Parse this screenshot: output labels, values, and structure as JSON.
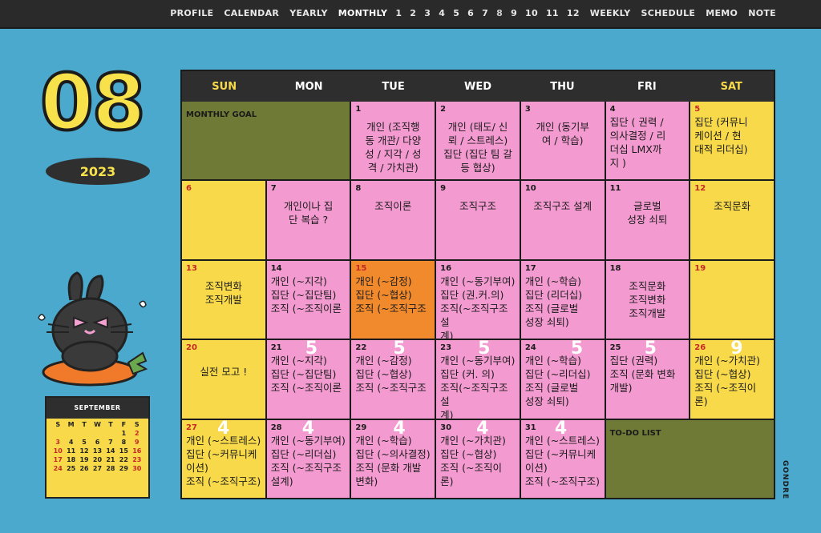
{
  "nav": {
    "items": [
      "PROFILE",
      "CALENDAR",
      "YEARLY",
      "MONTHLY"
    ],
    "months": [
      "1",
      "2",
      "3",
      "4",
      "5",
      "6",
      "7",
      "8",
      "9",
      "10",
      "11",
      "12"
    ],
    "items2": [
      "WEEKLY",
      "SCHEDULE",
      "MEMO",
      "NOTE"
    ]
  },
  "month": "08",
  "year": "2023",
  "mini": {
    "title": "SEPTEMBER",
    "dow": [
      "S",
      "M",
      "T",
      "W",
      "T",
      "F",
      "S"
    ],
    "days": [
      "",
      "",
      "",
      "",
      "",
      "1",
      "2",
      "3",
      "4",
      "5",
      "6",
      "7",
      "8",
      "9",
      "10",
      "11",
      "12",
      "13",
      "14",
      "15",
      "16",
      "17",
      "18",
      "19",
      "20",
      "21",
      "22",
      "23",
      "24",
      "25",
      "26",
      "27",
      "28",
      "29",
      "30"
    ]
  },
  "weekdays": [
    "SUN",
    "MON",
    "TUE",
    "WED",
    "THU",
    "FRI",
    "SAT"
  ],
  "goal_label": "MONTHLY GOAL",
  "todo_label": "TO-DO LIST",
  "cells": {
    "d1": {
      "n": "1",
      "t": "개인 (조직행\n동 개관/ 다양\n성 / 지각 / 성\n격 / 가치관)"
    },
    "d2": {
      "n": "2",
      "t": "개인 (태도/ 신\n뢰 / 스트레스)\n집단 (집단 팀 갈\n등 협상)"
    },
    "d3": {
      "n": "3",
      "t": "개인 (동기부\n여 / 학습)"
    },
    "d4": {
      "n": "4",
      "t": "집단 ( 권력 /\n의사결정 / 리\n더십 LMX까\n지 )"
    },
    "d5": {
      "n": "5",
      "t": "집단 (커뮤니\n케이션 / 현\n대적 리더십)"
    },
    "d6": {
      "n": "6",
      "t": ""
    },
    "d7": {
      "n": "7",
      "t": "개인이나 집\n단 복습 ?"
    },
    "d8": {
      "n": "8",
      "t": "조직이론"
    },
    "d9": {
      "n": "9",
      "t": "조직구조"
    },
    "d10": {
      "n": "10",
      "t": "조직구조 설계"
    },
    "d11": {
      "n": "11",
      "t": "글로벌\n성장 쇠퇴"
    },
    "d12": {
      "n": "12",
      "t": "조직문화"
    },
    "d13": {
      "n": "13",
      "t": "조직변화\n조직개발"
    },
    "d14": {
      "n": "14",
      "t": "개인 (~지각)\n집단 (~집단팀)\n조직 (~조직이론"
    },
    "d15": {
      "n": "15",
      "t": "개인 (~감정)\n집단 (~협상)\n조직 (~조직구조"
    },
    "d16": {
      "n": "16",
      "t": "개인 (~동기부여)\n집단 (권.커.의)\n조직(~조직구조설\n계)"
    },
    "d17": {
      "n": "17",
      "t": "개인 (~학습)\n집단 (리더십)\n조직 (글로벌\n성장 쇠퇴)"
    },
    "d18": {
      "n": "18",
      "t": "조직문화\n조직변화\n조직개발"
    },
    "d19": {
      "n": "19",
      "t": ""
    },
    "d20": {
      "n": "20",
      "t": "실전 모고 !"
    },
    "d21": {
      "n": "21",
      "t": "개인 (~지각)\n집단 (~집단팀)\n조직 (~조직이론",
      "h": "5"
    },
    "d22": {
      "n": "22",
      "t": "개인 (~감정)\n집단 (~협상)\n조직 (~조직구조",
      "h": "5"
    },
    "d23": {
      "n": "23",
      "t": "개인 (~동기부여)\n집단 (커. 의)\n조직(~조직구조설\n계)",
      "h": "5"
    },
    "d24": {
      "n": "24",
      "t": "개인 (~학습)\n집단 (~리더십)\n조직 (글로벌\n성장 쇠퇴)",
      "h": "5"
    },
    "d25": {
      "n": "25",
      "t": "집단 (권력)\n조직 (문화 변화\n개발)",
      "h": "5"
    },
    "d26": {
      "n": "26",
      "t": "개인 (~가치관)\n집단 (~협상)\n조직 (~조직이\n론)",
      "h": "9"
    },
    "d27": {
      "n": "27",
      "t": "개인 (~스트레스)\n집단 (~커뮤니케\n이션)\n조직 (~조직구조)",
      "h": "4"
    },
    "d28": {
      "n": "28",
      "t": "개인 (~동기부여)\n집단 (~리더십)\n조직 (~조직구조\n설계)",
      "h": "4"
    },
    "d29": {
      "n": "29",
      "t": "개인 (~학습)\n집단 (~의사결정)\n조직 (문화 개발\n변화)",
      "h": "4"
    },
    "d30": {
      "n": "30",
      "t": "개인 (~가치관)\n집단 (~협상)\n조직 (~조직이\n론)",
      "h": "4"
    },
    "d31": {
      "n": "31",
      "t": "개인 (~스트레스)\n집단 (~커뮤니케\n이션)\n조직 (~조직구조)",
      "h": "4"
    }
  },
  "brand": "GONDRE"
}
